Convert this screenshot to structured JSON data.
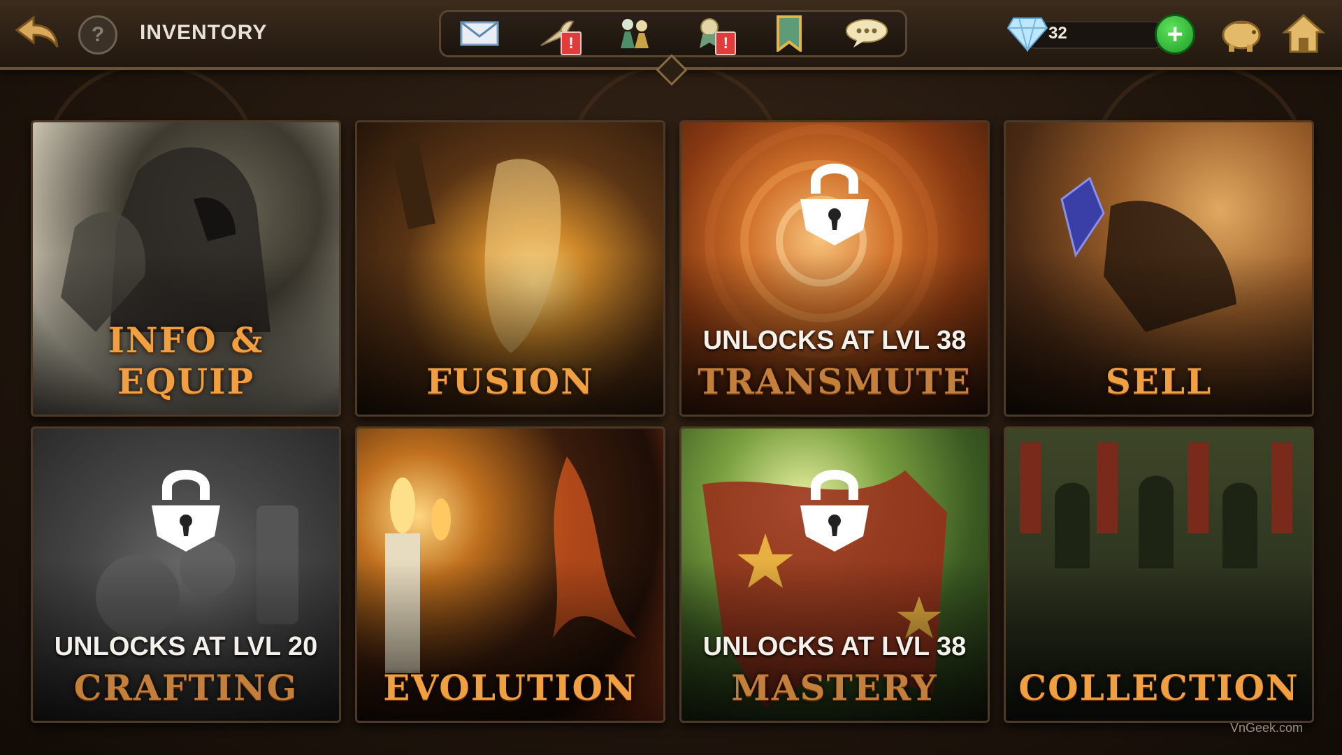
{
  "header": {
    "title": "INVENTORY",
    "help_symbol": "?",
    "nav_icons": [
      {
        "name": "mail-icon",
        "alert": false
      },
      {
        "name": "horn-icon",
        "alert": true
      },
      {
        "name": "friends-icon",
        "alert": false
      },
      {
        "name": "achievements-icon",
        "alert": true
      },
      {
        "name": "bookmark-icon",
        "alert": false
      },
      {
        "name": "chat-icon",
        "alert": false
      }
    ],
    "alert_mark": "!",
    "gems": "32",
    "add_symbol": "+"
  },
  "tiles": [
    {
      "label": "INFO & EQUIP",
      "locked": false,
      "unlock_text": ""
    },
    {
      "label": "FUSION",
      "locked": false,
      "unlock_text": ""
    },
    {
      "label": "TRANSMUTE",
      "locked": true,
      "unlock_text": "UNLOCKS AT LVL 38"
    },
    {
      "label": "SELL",
      "locked": false,
      "unlock_text": ""
    },
    {
      "label": "CRAFTING",
      "locked": true,
      "unlock_text": "UNLOCKS AT LVL 20"
    },
    {
      "label": "EVOLUTION",
      "locked": false,
      "unlock_text": ""
    },
    {
      "label": "MASTERY",
      "locked": true,
      "unlock_text": "UNLOCKS AT LVL 38"
    },
    {
      "label": "COLLECTION",
      "locked": false,
      "unlock_text": ""
    }
  ],
  "watermark": "VnGeek.com",
  "colors": {
    "label_orange": "#f0a040",
    "alert_red": "#e23b3b",
    "add_green": "#2fbf3a",
    "gem_blue": "#8fd3ff"
  }
}
